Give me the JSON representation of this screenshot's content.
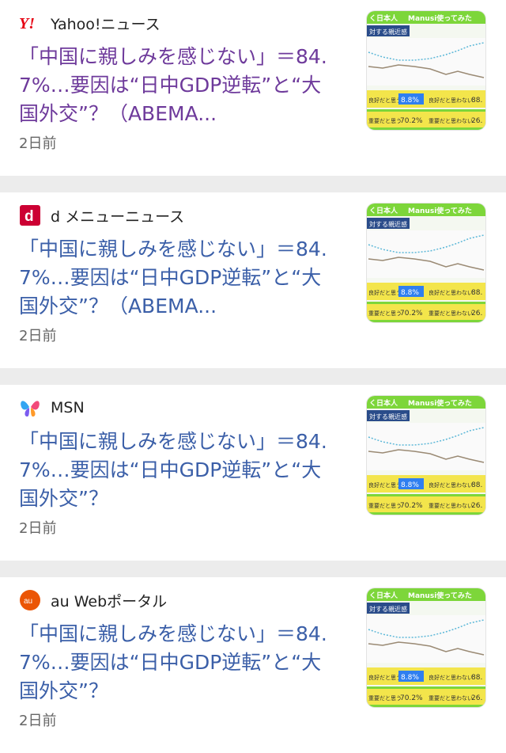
{
  "cards": [
    {
      "source": "Yahoo!ニュース",
      "logo": "yahoo-logo",
      "title": "「中国に親しみを感じない」＝84.7%…要因は“日中GDP逆転”と“大国外交”？（ABEMA...",
      "time": "2日前",
      "visited": true
    },
    {
      "source": "d メニューニュース",
      "logo": "dmenu-logo",
      "title": "「中国に親しみを感じない」＝84.7%…要因は“日中GDP逆転”と“大国外交”？（ABEMA...",
      "time": "2日前",
      "visited": false
    },
    {
      "source": "MSN",
      "logo": "msn-butterfly-logo",
      "title": "「中国に親しみを感じない」＝84.7%…要因は“日中GDP逆転”と“大国外交”？",
      "time": "2日前",
      "visited": false
    },
    {
      "source": "au Webポータル",
      "logo": "au-logo",
      "title": "「中国に親しみを感じない」＝84.7%…要因は“日中GDP逆転”と“大国外交”？",
      "time": "2日前",
      "visited": false
    }
  ],
  "thumbnail": {
    "header_left": "く日本人",
    "header_right": "Manusi使ってみた",
    "subheader": "対する親近感",
    "row1_left_label": "良好だと思う",
    "row1_left_value": "8.8%",
    "row1_right_label": "良好だと思わない",
    "row1_right_value": "88.",
    "row2_left_label": "重要だと思う",
    "row2_left_value": "70.2%",
    "row2_right_label": "重要だと思わない",
    "row2_right_value": "26.",
    "colors": {
      "green": "#7dd63a",
      "yellow": "#f3e54b",
      "blue": "#2f7ff0",
      "line1": "#9a8a74",
      "line2": "#5db8d8"
    }
  }
}
